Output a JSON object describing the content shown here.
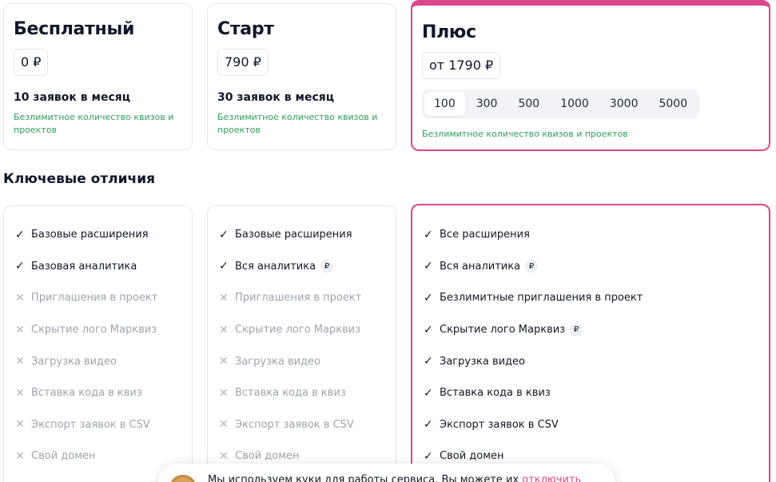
{
  "plans": [
    {
      "title": "Бесплатный",
      "price": "0 ₽",
      "limit": "10 заявок в месяц",
      "note": "Безлимитное количество квизов и проектов"
    },
    {
      "title": "Старт",
      "price": "790 ₽",
      "limit": "30 заявок в месяц",
      "note": "Безлимитное количество квизов и проектов"
    },
    {
      "title": "Плюс",
      "price": "от 1790 ₽",
      "options": [
        "100",
        "300",
        "500",
        "1000",
        "3000",
        "5000"
      ],
      "selected_option": "100",
      "note": "Безлимитное количество квизов и проектов",
      "accent_color": "#d9488b"
    }
  ],
  "section_title": "Ключевые отличия",
  "features": [
    {
      "items": [
        {
          "label": "Базовые расширения",
          "included": true
        },
        {
          "label": "Базовая аналитика",
          "included": true
        },
        {
          "label": "Приглашения в проект",
          "included": false
        },
        {
          "label": "Скрытие лого Марквиз",
          "included": false
        },
        {
          "label": "Загрузка видео",
          "included": false
        },
        {
          "label": "Вставка кода в квиз",
          "included": false
        },
        {
          "label": "Экспорт заявок в CSV",
          "included": false
        },
        {
          "label": "Свой домен",
          "included": false
        }
      ]
    },
    {
      "items": [
        {
          "label": "Базовые расширения",
          "included": true
        },
        {
          "label": "Вся аналитика",
          "included": true,
          "paid": "₽"
        },
        {
          "label": "Приглашения в проект",
          "included": false
        },
        {
          "label": "Скрытие лого Марквиз",
          "included": false
        },
        {
          "label": "Загрузка видео",
          "included": false
        },
        {
          "label": "Вставка кода в квиз",
          "included": false
        },
        {
          "label": "Экспорт заявок в CSV",
          "included": false
        },
        {
          "label": "Свой домен",
          "included": false
        }
      ]
    },
    {
      "items": [
        {
          "label": "Все расширения",
          "included": true
        },
        {
          "label": "Вся аналитика",
          "included": true,
          "paid": "₽"
        },
        {
          "label": "Безлимитные приглашения в проект",
          "included": true
        },
        {
          "label": "Скрытие лого Марквиз",
          "included": true,
          "paid": "₽"
        },
        {
          "label": "Загрузка видео",
          "included": true
        },
        {
          "label": "Вставка кода в квиз",
          "included": true
        },
        {
          "label": "Экспорт заявок в CSV",
          "included": true
        },
        {
          "label": "Свой домен",
          "included": true
        }
      ]
    }
  ],
  "icons": {
    "included": "check-icon",
    "excluded": "cross-icon",
    "cookie": "cookie-icon"
  },
  "cookie_banner": {
    "text": "Мы используем куки для работы сервиса. Вы можете их ",
    "link": "отключить"
  }
}
